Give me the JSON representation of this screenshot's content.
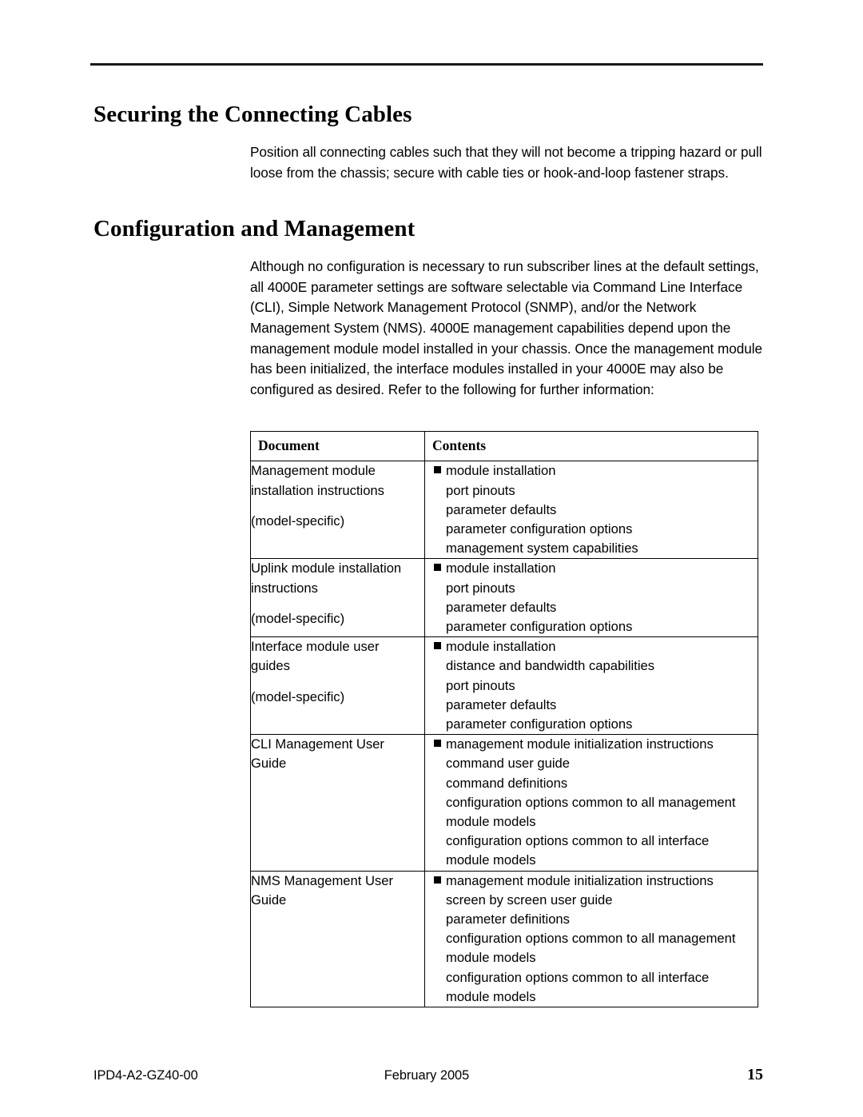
{
  "document": {
    "sections": [
      {
        "heading": "Securing the Connecting Cables",
        "paragraph": "Position all connecting cables such that they will not become a tripping hazard or pull loose from the chassis; secure with cable ties or hook-and-loop fastener straps."
      },
      {
        "heading": "Configuration and Management",
        "paragraph": "Although no configuration is necessary to run subscriber lines at the default settings, all 4000E parameter settings are software selectable via Command Line Interface (CLI), Simple Network Management Protocol (SNMP), and/or the Network Management System (NMS). 4000E management capabilities depend upon the management module model installed in your chassis. Once the management module has been initialized, the interface modules installed in your 4000E may also be configured as desired. Refer to the following for further information:"
      }
    ]
  },
  "table": {
    "headers": [
      "Document",
      "Contents"
    ],
    "rows": [
      {
        "document_lines": [
          "Management module",
          "installation instructions"
        ],
        "document_note": "(model-specific)",
        "bullet": "■",
        "contents": [
          "module installation",
          "port pinouts",
          "parameter defaults",
          "parameter configuration options",
          "management system capabilities"
        ]
      },
      {
        "document_lines": [
          "Uplink module installation",
          "instructions"
        ],
        "document_note": "(model-specific)",
        "bullet": "■",
        "contents": [
          "module installation",
          "port pinouts",
          "parameter defaults",
          "parameter configuration options"
        ]
      },
      {
        "document_lines": [
          "Interface module user",
          "guides"
        ],
        "document_note": "(model-specific)",
        "bullet": "■",
        "contents": [
          "module installation",
          "distance and bandwidth capabilities",
          "port pinouts",
          "parameter defaults",
          "parameter configuration options"
        ]
      },
      {
        "document_lines": [
          "CLI Management User",
          "Guide"
        ],
        "document_note": "",
        "bullet": "■",
        "contents": [
          "management module initialization instructions",
          "command user guide",
          "command definitions",
          "configuration options common to all management module models",
          "configuration options common to all interface module models"
        ]
      },
      {
        "document_lines": [
          "NMS Management User",
          "Guide"
        ],
        "document_note": "",
        "bullet": "■",
        "contents": [
          "management module initialization instructions",
          "screen by screen user guide",
          "parameter definitions",
          "configuration options common to all management module models",
          "configuration options common to all interface module models"
        ]
      }
    ]
  },
  "footer": {
    "document_id": "IPD4-A2-GZ40-00",
    "date": "February 2005",
    "page_number": "15"
  }
}
